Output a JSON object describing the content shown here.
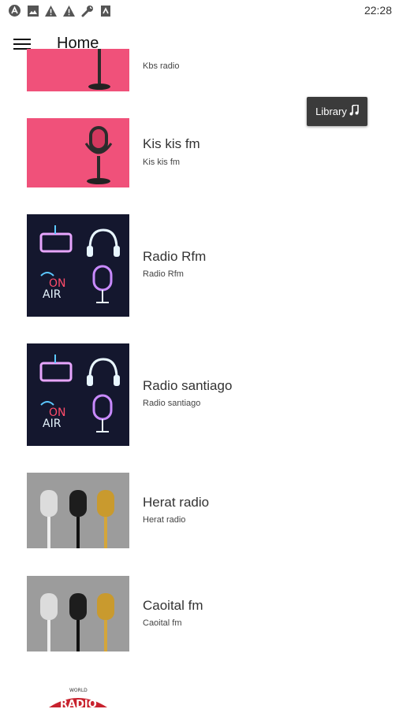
{
  "status_bar": {
    "time": "22:28"
  },
  "app_bar": {
    "title": "Home"
  },
  "library_button": {
    "label": "Library"
  },
  "stations": [
    {
      "name": "",
      "subtitle": "Kbs radio",
      "art": "pink-mic"
    },
    {
      "name": "Kis kis fm",
      "subtitle": "Kis kis fm",
      "art": "pink-mic"
    },
    {
      "name": "Radio Rfm",
      "subtitle": "Radio Rfm",
      "art": "neon-radio"
    },
    {
      "name": "Radio santiago",
      "subtitle": "Radio santiago",
      "art": "neon-radio"
    },
    {
      "name": "Herat radio",
      "subtitle": "Herat radio",
      "art": "vintage-mics"
    },
    {
      "name": "Caoital fm",
      "subtitle": "Caoital fm",
      "art": "vintage-mics"
    },
    {
      "name": "",
      "subtitle": "",
      "art": "world-radio-logo"
    }
  ],
  "neon_art_text": {
    "line1": "ON",
    "line2": "AIR"
  },
  "logo_art_text": {
    "small": "WORLD",
    "big": "RADIO"
  },
  "colors": {
    "pink": "#f0517a",
    "neon_bg": "#14172e",
    "gray_bg": "#9c9c9c"
  }
}
